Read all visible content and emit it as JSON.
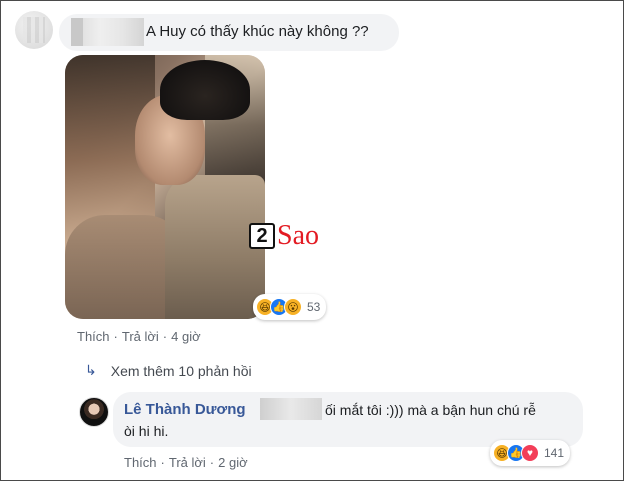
{
  "comment": {
    "text": "A Huy có thấy khúc này không ??",
    "reactions": {
      "icons": [
        "haha-icon",
        "like-icon",
        "wow-icon"
      ],
      "count": "53"
    },
    "actions": {
      "like": "Thích",
      "reply": "Trả lời",
      "time": "4 giờ"
    },
    "photo_watermark": {
      "number": "2",
      "brand": "Sao"
    }
  },
  "more_replies": {
    "label": "Xem thêm 10 phản hồi"
  },
  "reply": {
    "author": "Lê Thành Dương",
    "line1": "ối mắt tôi :))) mà a bận hun chú rễ",
    "line2": "òi hi hi.",
    "reactions": {
      "icons": [
        "haha-icon",
        "like-icon",
        "love-icon"
      ],
      "count": "141"
    },
    "actions": {
      "like": "Thích",
      "reply": "Trả lời",
      "time": "2 giờ"
    }
  },
  "colors": {
    "link": "#385898",
    "bubble": "#f2f3f5",
    "meta": "#606770",
    "watermark_red": "#e31b23"
  }
}
